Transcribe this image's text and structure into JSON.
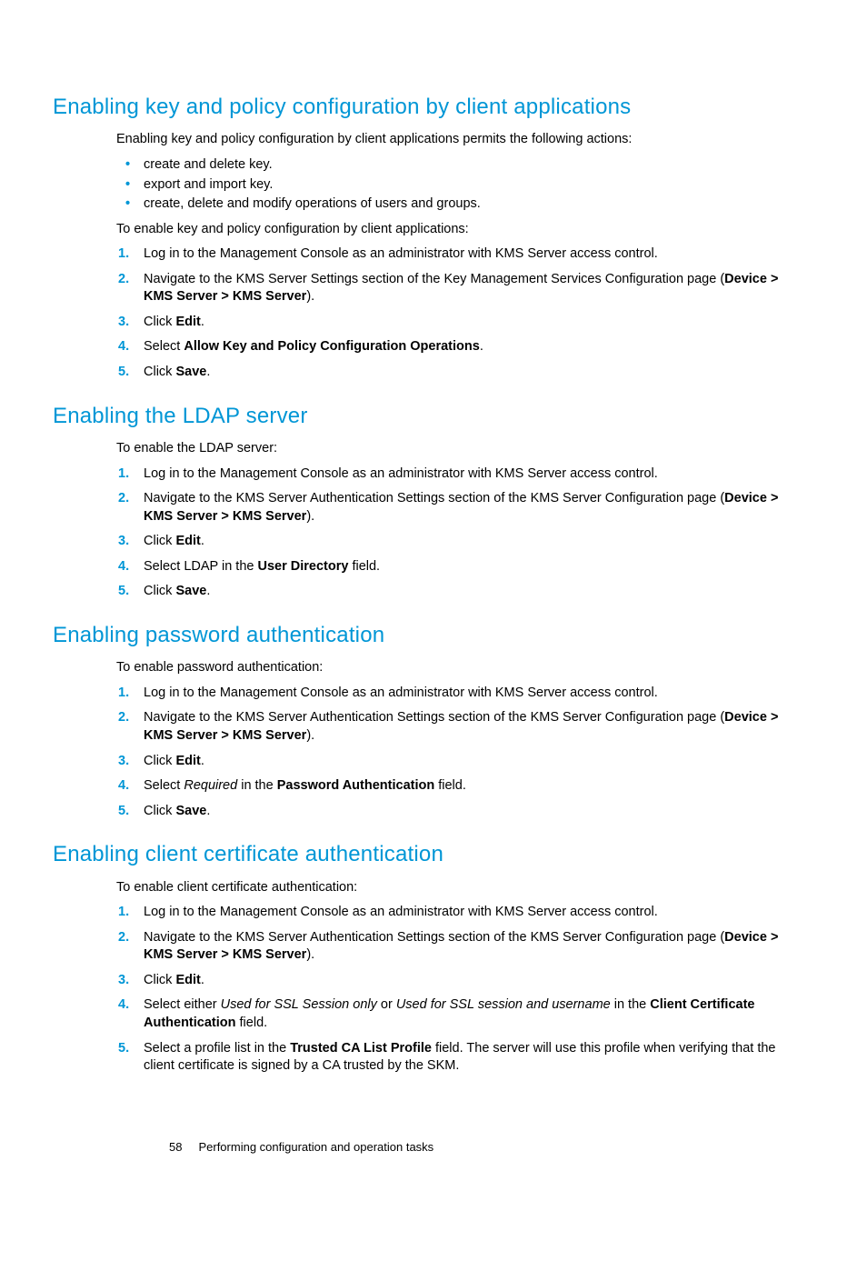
{
  "footer": {
    "page_number": "58",
    "title": "Performing configuration and operation tasks"
  },
  "sections": [
    {
      "heading": "Enabling key and policy configuration by client applications",
      "intro": "Enabling key and policy configuration by client applications permits the following actions:",
      "bullets": [
        "create and delete key.",
        "export and import key.",
        "create, delete and modify operations of users and groups."
      ],
      "lead": "To enable key and policy configuration by client applications:",
      "steps": [
        [
          {
            "t": "Log in to the Management Console as an administrator with KMS Server access control."
          }
        ],
        [
          {
            "t": "Navigate to the KMS Server Settings section of the Key Management Services Configuration page ("
          },
          {
            "t": "Device > KMS Server > KMS Server",
            "b": true
          },
          {
            "t": ")."
          }
        ],
        [
          {
            "t": "Click "
          },
          {
            "t": "Edit",
            "b": true
          },
          {
            "t": "."
          }
        ],
        [
          {
            "t": "Select "
          },
          {
            "t": "Allow Key and Policy Configuration Operations",
            "b": true
          },
          {
            "t": "."
          }
        ],
        [
          {
            "t": "Click "
          },
          {
            "t": "Save",
            "b": true
          },
          {
            "t": "."
          }
        ]
      ]
    },
    {
      "heading": "Enabling the LDAP server",
      "lead": "To enable the LDAP server:",
      "steps": [
        [
          {
            "t": "Log in to the Management Console as an administrator with KMS Server access control."
          }
        ],
        [
          {
            "t": "Navigate to the KMS Server Authentication Settings section of the KMS Server Configuration page ("
          },
          {
            "t": "Device > KMS Server > KMS Server",
            "b": true
          },
          {
            "t": ")."
          }
        ],
        [
          {
            "t": "Click "
          },
          {
            "t": "Edit",
            "b": true
          },
          {
            "t": "."
          }
        ],
        [
          {
            "t": "Select LDAP in the "
          },
          {
            "t": "User Directory",
            "b": true
          },
          {
            "t": " field."
          }
        ],
        [
          {
            "t": "Click "
          },
          {
            "t": "Save",
            "b": true
          },
          {
            "t": "."
          }
        ]
      ]
    },
    {
      "heading": "Enabling password authentication",
      "lead": "To enable password authentication:",
      "steps": [
        [
          {
            "t": "Log in to the Management Console as an administrator with KMS Server access control."
          }
        ],
        [
          {
            "t": "Navigate to the KMS Server Authentication Settings section of the KMS Server Configuration page ("
          },
          {
            "t": "Device > KMS Server > KMS Server",
            "b": true
          },
          {
            "t": ")."
          }
        ],
        [
          {
            "t": "Click "
          },
          {
            "t": "Edit",
            "b": true
          },
          {
            "t": "."
          }
        ],
        [
          {
            "t": "Select "
          },
          {
            "t": "Required",
            "i": true
          },
          {
            "t": " in the "
          },
          {
            "t": "Password Authentication",
            "b": true
          },
          {
            "t": " field."
          }
        ],
        [
          {
            "t": "Click "
          },
          {
            "t": "Save",
            "b": true
          },
          {
            "t": "."
          }
        ]
      ]
    },
    {
      "heading": "Enabling client certificate authentication",
      "lead": "To enable client certificate authentication:",
      "steps": [
        [
          {
            "t": "Log in to the Management Console as an administrator with KMS Server access control."
          }
        ],
        [
          {
            "t": "Navigate to the KMS Server Authentication Settings section of the KMS Server Configuration page ("
          },
          {
            "t": "Device > KMS Server > KMS Server",
            "b": true
          },
          {
            "t": ")."
          }
        ],
        [
          {
            "t": "Click "
          },
          {
            "t": "Edit",
            "b": true
          },
          {
            "t": "."
          }
        ],
        [
          {
            "t": "Select either "
          },
          {
            "t": "Used for SSL Session only",
            "i": true
          },
          {
            "t": " or "
          },
          {
            "t": "Used for SSL session and username",
            "i": true
          },
          {
            "t": " in the "
          },
          {
            "t": "Client Certificate Authentication",
            "b": true
          },
          {
            "t": " field."
          }
        ],
        [
          {
            "t": "Select a profile list in the "
          },
          {
            "t": "Trusted CA List Profile",
            "b": true
          },
          {
            "t": " field.  The server will use this profile when verifying that the client certificate is signed by a CA trusted by the SKM."
          }
        ]
      ]
    }
  ]
}
